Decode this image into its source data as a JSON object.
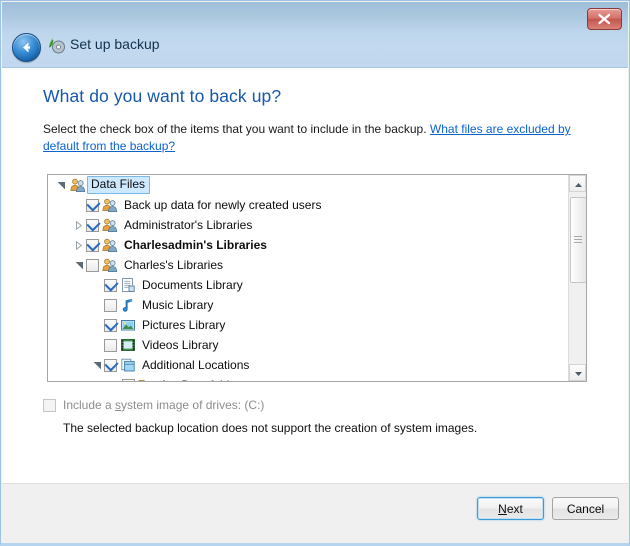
{
  "window": {
    "title": "Set up backup",
    "title_icon": "backup-disk-icon",
    "back_icon": "back-arrow-icon",
    "close_icon": "close-icon"
  },
  "page": {
    "heading": "What do you want to back up?",
    "description_text": "Select the check box of the items that you want to include in the backup. ",
    "description_link": "What files are excluded by default from the backup?"
  },
  "tree": {
    "items": [
      {
        "label": "Data Files",
        "indent": 0,
        "expander": "expanded",
        "checkbox": "none",
        "icon": "users-icon",
        "selected": true,
        "bold": false
      },
      {
        "label": "Back up data for newly created users",
        "indent": 1,
        "expander": "none",
        "checkbox": "checked",
        "icon": "users-icon",
        "selected": false,
        "bold": false
      },
      {
        "label": "Administrator's Libraries",
        "indent": 1,
        "expander": "collapsed",
        "checkbox": "checked",
        "icon": "users-icon",
        "selected": false,
        "bold": false
      },
      {
        "label": "Charlesadmin's Libraries",
        "indent": 1,
        "expander": "collapsed",
        "checkbox": "checked",
        "icon": "users-icon",
        "selected": false,
        "bold": true
      },
      {
        "label": "Charles's Libraries",
        "indent": 1,
        "expander": "expanded",
        "checkbox": "unchecked",
        "icon": "users-icon",
        "selected": false,
        "bold": false
      },
      {
        "label": "Documents Library",
        "indent": 2,
        "expander": "none",
        "checkbox": "checked",
        "icon": "document-library-icon",
        "selected": false,
        "bold": false
      },
      {
        "label": "Music Library",
        "indent": 2,
        "expander": "none",
        "checkbox": "unchecked",
        "icon": "music-library-icon",
        "selected": false,
        "bold": false
      },
      {
        "label": "Pictures Library",
        "indent": 2,
        "expander": "none",
        "checkbox": "checked",
        "icon": "pictures-library-icon",
        "selected": false,
        "bold": false
      },
      {
        "label": "Videos Library",
        "indent": 2,
        "expander": "none",
        "checkbox": "unchecked",
        "icon": "videos-library-icon",
        "selected": false,
        "bold": false
      },
      {
        "label": "Additional Locations",
        "indent": 2,
        "expander": "expanded",
        "checkbox": "checked",
        "icon": "additional-locations-icon",
        "selected": false,
        "bold": false
      },
      {
        "label": "AppData folder",
        "indent": 3,
        "expander": "none",
        "checkbox": "checked",
        "icon": "folder-icon",
        "selected": false,
        "bold": false
      },
      {
        "label": "",
        "indent": 3,
        "expander": "none",
        "checkbox": "unchecked",
        "icon": "folder-icon",
        "selected": false,
        "bold": false
      }
    ],
    "scrollbar": {
      "up_icon": "scroll-up-icon",
      "down_icon": "scroll-down-icon"
    }
  },
  "system_image": {
    "checkbox_label_before": "Include a ",
    "checkbox_label_accel": "s",
    "checkbox_label_after": "ystem image of drives: (C:)",
    "checked": false,
    "enabled": false,
    "note": "The selected backup location does not support the creation of system images."
  },
  "footer": {
    "next_before": "",
    "next_accel": "N",
    "next_after": "ext",
    "cancel_label": "Cancel"
  },
  "colors": {
    "heading": "#1558ad",
    "link": "#0b63ce",
    "titlebar_top": "#9ebdd9",
    "titlebar_bottom": "#c0d7ed",
    "close_red": "#c3564f",
    "selection": "#cde8ff",
    "check_blue": "#2b6bbf",
    "window_border": "#9dc2e3"
  }
}
